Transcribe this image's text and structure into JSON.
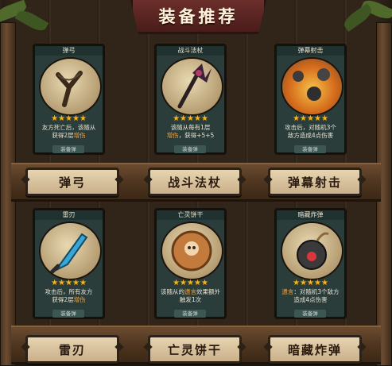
{
  "header": {
    "title": "装备推荐"
  },
  "cards": [
    {
      "name": "弹弓",
      "stars": "★★★★★",
      "desc_a": "友方死亡后，该随从",
      "desc_b": "获得2层",
      "desc_hl": "增伤",
      "desc_c": "",
      "tag": "装备弹",
      "label": "弹弓",
      "art_icon": "slingshot-icon"
    },
    {
      "name": "战斗法杖",
      "stars": "★★★★★",
      "desc_a": "该随从每有1层",
      "desc_b": "",
      "desc_hl": "增伤",
      "desc_c": "，获得+5+5",
      "tag": "装备弹",
      "label": "战斗法杖",
      "art_icon": "battle-staff-icon"
    },
    {
      "name": "弹幕射击",
      "stars": "★★★★★",
      "desc_a": "攻击后，对随机3个",
      "desc_b": "敌方造成4点伤害",
      "desc_hl": "",
      "desc_c": "",
      "tag": "装备弹",
      "label": "弹幕射击",
      "art_icon": "barrage-icon"
    },
    {
      "name": "雷刃",
      "stars": "★★★★★",
      "desc_a": "攻击后，所有友方",
      "desc_b": "获得2层",
      "desc_hl": "增伤",
      "desc_c": "",
      "tag": "装备弹",
      "label": "雷刃",
      "art_icon": "thunder-blade-icon"
    },
    {
      "name": "亡灵饼干",
      "stars": "★★★★★",
      "desc_a": "该随从的",
      "desc_b": "",
      "desc_hl": "遗言",
      "desc_c": "效果额外触发1次",
      "tag": "装备弹",
      "label": "亡灵饼干",
      "art_icon": "undead-cookie-icon"
    },
    {
      "name": "暗藏炸弹",
      "stars": "★★★★★",
      "desc_a": "",
      "desc_b": "",
      "desc_hl": "遗言",
      "desc_c": "：对随机3个敌方造成4点伤害",
      "tag": "装备弹",
      "label": "暗藏炸弹",
      "art_icon": "hidden-bomb-icon"
    }
  ],
  "colors": {
    "card_bg": "#2a3d3a",
    "star": "#f3b51f",
    "highlight": "#f3a33d",
    "title_banner": "#5a2523"
  }
}
